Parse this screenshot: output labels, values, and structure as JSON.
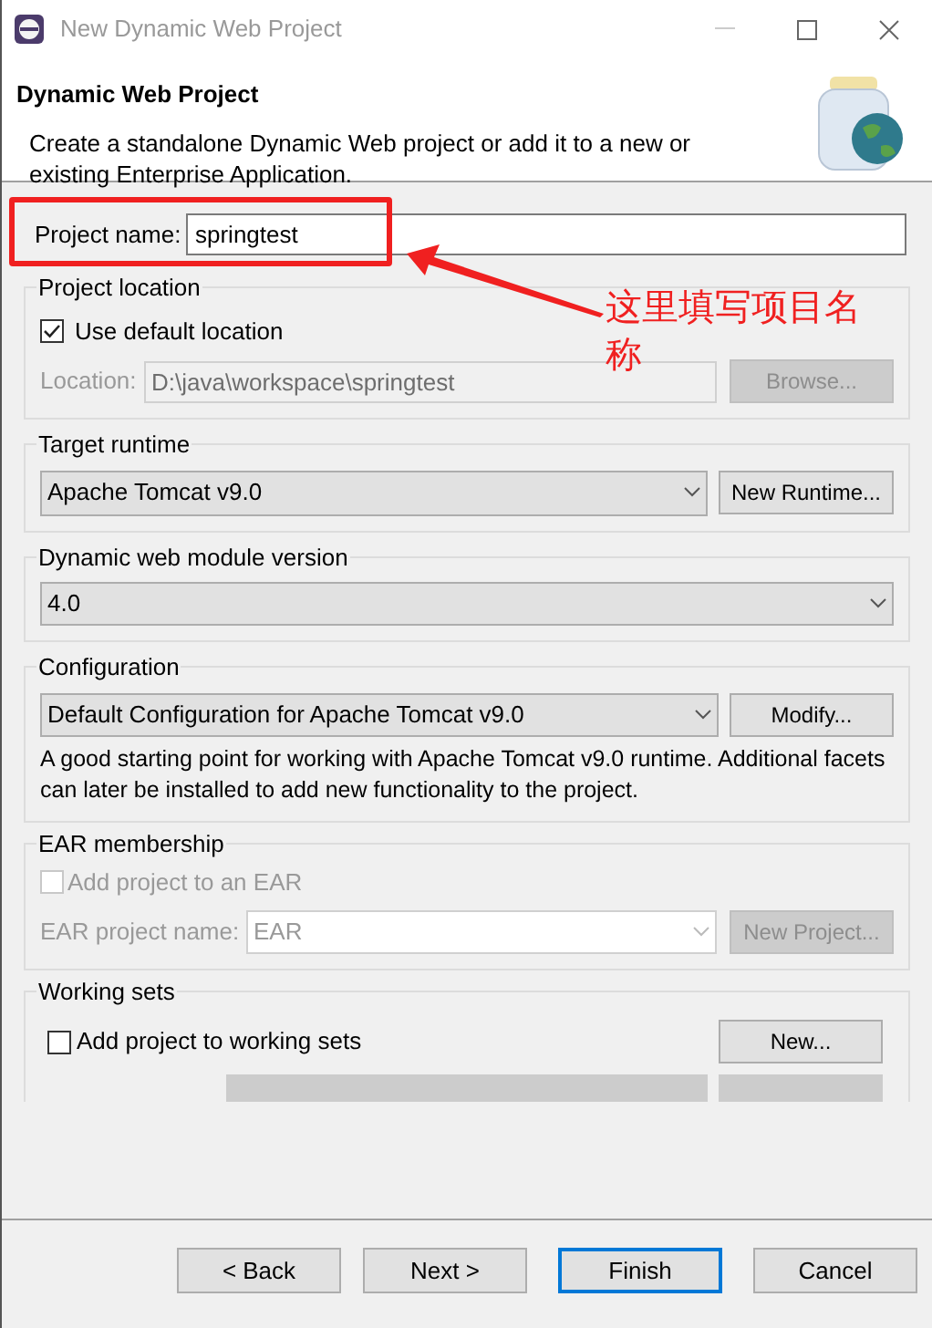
{
  "window": {
    "title": "New Dynamic Web Project"
  },
  "header": {
    "title": "Dynamic Web Project",
    "description": "Create a standalone Dynamic Web project or add it to a new or existing Enterprise Application."
  },
  "project_name": {
    "label": "Project name:",
    "value": "springtest"
  },
  "project_location": {
    "title": "Project location",
    "use_default": {
      "label": "Use default location",
      "checked": true
    },
    "location": {
      "label": "Location:",
      "value": "D:\\java\\workspace\\springtest",
      "disabled": true
    },
    "browse": {
      "label": "Browse...",
      "disabled": true
    }
  },
  "target_runtime": {
    "title": "Target runtime",
    "value": "Apache Tomcat v9.0",
    "button": "New Runtime..."
  },
  "module_version": {
    "title": "Dynamic web module version",
    "value": "4.0"
  },
  "configuration": {
    "title": "Configuration",
    "value": "Default Configuration for Apache Tomcat v9.0",
    "button": "Modify...",
    "description": "A good starting point for working with Apache Tomcat v9.0 runtime. Additional facets can later be installed to add new functionality to the project."
  },
  "ear_membership": {
    "title": "EAR membership",
    "add": {
      "label": "Add project to an EAR",
      "checked": false,
      "disabled": true
    },
    "name": {
      "label": "EAR project name:",
      "value": "EAR",
      "disabled": true
    },
    "button": {
      "label": "New Project...",
      "disabled": true
    }
  },
  "working_sets": {
    "title": "Working sets",
    "add": {
      "label": "Add project to working sets",
      "checked": false
    },
    "button": "New..."
  },
  "buttons": [
    {
      "label": "< Back",
      "default": false
    },
    {
      "label": "Next >",
      "default": false
    },
    {
      "label": "Finish",
      "default": true
    },
    {
      "label": "Cancel",
      "default": false
    }
  ],
  "annotation": {
    "text": "这里填写项目名称"
  }
}
